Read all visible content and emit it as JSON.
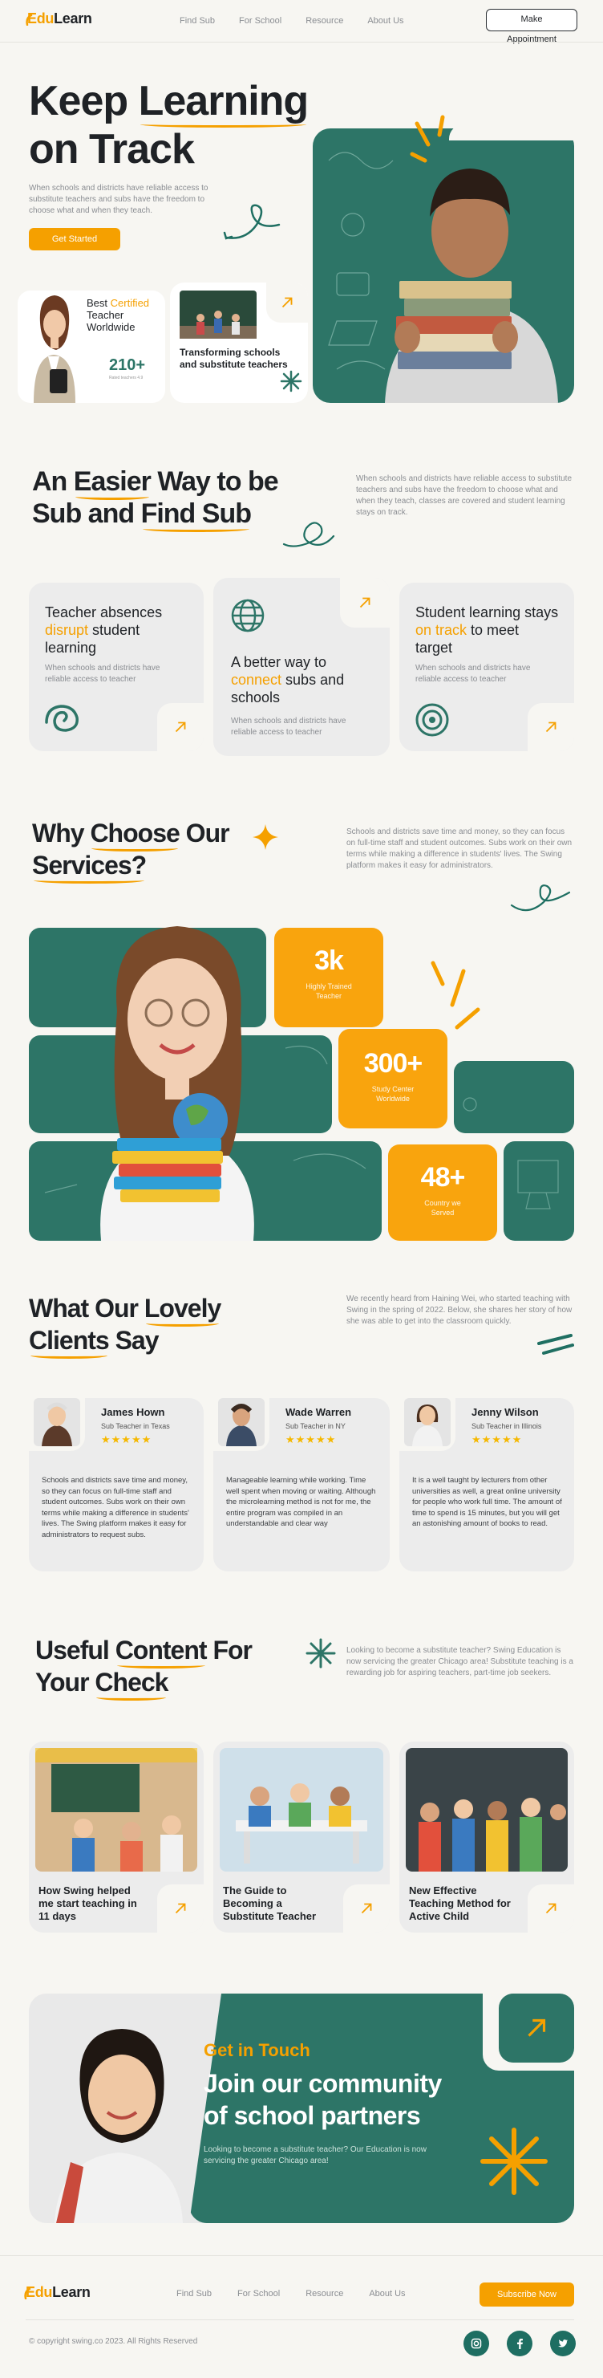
{
  "brand": {
    "edu": "Edu",
    "learn": "Learn"
  },
  "nav": {
    "links": [
      "Find Sub",
      "For School",
      "Resource",
      "About Us"
    ],
    "cta": "Make Appointment"
  },
  "hero": {
    "title_a": "Keep ",
    "title_b": "Learning",
    "title_c": "on Track",
    "desc": "When schools and districts have reliable access to substitute teachers and subs have the freedom to choose what and when they teach.",
    "cta": "Get Started",
    "cert_a": "Best ",
    "cert_b": "Certified",
    "cert_c": "Teacher Worldwide",
    "cert_num": "210+",
    "cert_small": "Rated teachers 4.9",
    "transform": "Transforming schools and substitute teachers"
  },
  "easier": {
    "title_a": "An ",
    "title_b": "Easier",
    "title_c": " Way to be",
    "title_d": "Sub and ",
    "title_e": "Find Sub",
    "desc": "When schools and districts have reliable access to substitute teachers and subs have the freedom to choose what and when they teach, classes are covered and student learning stays on track.",
    "cards": [
      {
        "a": "Teacher absences ",
        "b": "disrupt",
        "c": " student learning",
        "desc": "When schools and districts have reliable access to teacher"
      },
      {
        "a": "A better way to ",
        "b": "connect",
        "c": " subs and schools",
        "desc": "When schools and districts have reliable access to teacher"
      },
      {
        "a": "Student learning stays ",
        "b": "on track",
        "c": " to meet target",
        "desc": "When schools and districts have reliable access to teacher"
      }
    ]
  },
  "why": {
    "title_a": "Why ",
    "title_b": "Choose",
    "title_c": " Our",
    "title_d": "Services?",
    "desc": "Schools and districts save time and money, so they can focus on full-time staff and student outcomes. Subs work on their own terms while making a difference in students' lives. The Swing platform makes it easy for administrators.",
    "stats": [
      {
        "num": "3k",
        "label": "Highly Trained Teacher"
      },
      {
        "num": "300+",
        "label": "Study Center Worldwide"
      },
      {
        "num": "48+",
        "label": "Country we Served"
      }
    ]
  },
  "clients": {
    "title_a": "What Our ",
    "title_b": "Lovely",
    "title_c": "Clients",
    "title_d": " Say",
    "desc": "We recently heard from Haining Wei, who started teaching with Swing in the spring of 2022. Below, she shares her story of how she was able to get into the classroom quickly.",
    "stars": "★★★★★",
    "items": [
      {
        "name": "James Hown",
        "role": "Sub Teacher in Texas",
        "text": "Schools and districts save time and money, so they can focus on full-time staff and student outcomes. Subs work on their own terms while making a difference in students' lives. The Swing platform makes it easy for administrators to request subs."
      },
      {
        "name": "Wade Warren",
        "role": "Sub Teacher in NY",
        "text": "Manageable learning while working. Time well spent when moving or waiting. Although the microlearning method is not for me, the entire program was compiled in an understandable and clear way"
      },
      {
        "name": "Jenny Wilson",
        "role": "Sub Teacher in Illinois",
        "text": "It is a well taught by lecturers from other universities as well, a great online university for people who work full time. The amount of time to spend is 15 minutes, but you will get an astonishing amount of books to read."
      }
    ]
  },
  "content": {
    "title_a": "Useful ",
    "title_b": "Content",
    "title_c": " For",
    "title_d": "Your ",
    "title_e": "Check",
    "desc": "Looking to become a substitute teacher? Swing Education is now servicing the greater Chicago area! Substitute teaching is a rewarding job for aspiring teachers, part-time job seekers.",
    "posts": [
      {
        "title": "How Swing helped me start teaching in 11 days"
      },
      {
        "title": "The Guide to Becoming a Substitute Teacher"
      },
      {
        "title": "New Effective Teaching Method for Active Child"
      }
    ]
  },
  "cta": {
    "kicker": "Get in Touch",
    "title": "Join our community of school partners",
    "desc": "Looking to become a substitute teacher? Our Education is now servicing the greater Chicago area!"
  },
  "footer": {
    "links": [
      "Find Sub",
      "For School",
      "Resource",
      "About Us"
    ],
    "subscribe": "Subscribe Now",
    "copyright": "© copyright swing.co 2023. All Rights Reserved",
    "socials": [
      "instagram",
      "facebook",
      "twitter"
    ]
  },
  "colors": {
    "accent": "#f5a000",
    "teal": "#2d7567",
    "background": "#f7f6f2"
  }
}
